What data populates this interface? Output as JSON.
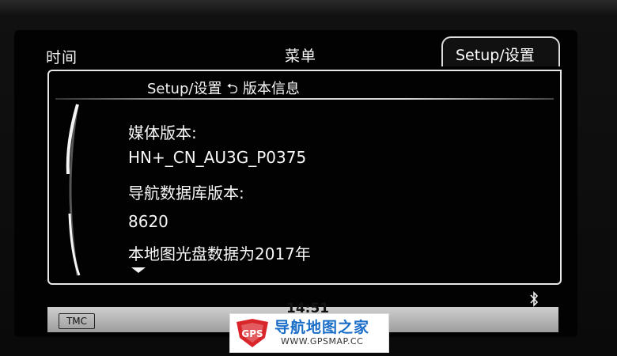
{
  "tabs": {
    "time": "时间",
    "menu": "菜单",
    "setup": "Setup/设置"
  },
  "breadcrumb": {
    "parent": "Setup/设置",
    "back_glyph": "⮌",
    "current": "版本信息"
  },
  "content": {
    "media_label": "媒体版本:",
    "media_value": "HN+_CN_AU3G_P0375",
    "nav_db_label": "导航数据库版本:",
    "nav_db_value": "8620",
    "disc_note": "本地图光盘数据为2017年"
  },
  "status_bar": {
    "tmc": "TMC",
    "clock": "14:51"
  },
  "watermark": {
    "logo_text": "GPS",
    "title": "导航地图之家",
    "url": "WWW.GPSMAP.CC"
  },
  "colors": {
    "screen_bg": "#020202",
    "text": "#f2f2f2",
    "status_bar": "#bdbdbd",
    "watermark_blue": "#1a6ec8",
    "watermark_red": "#d8262b"
  }
}
